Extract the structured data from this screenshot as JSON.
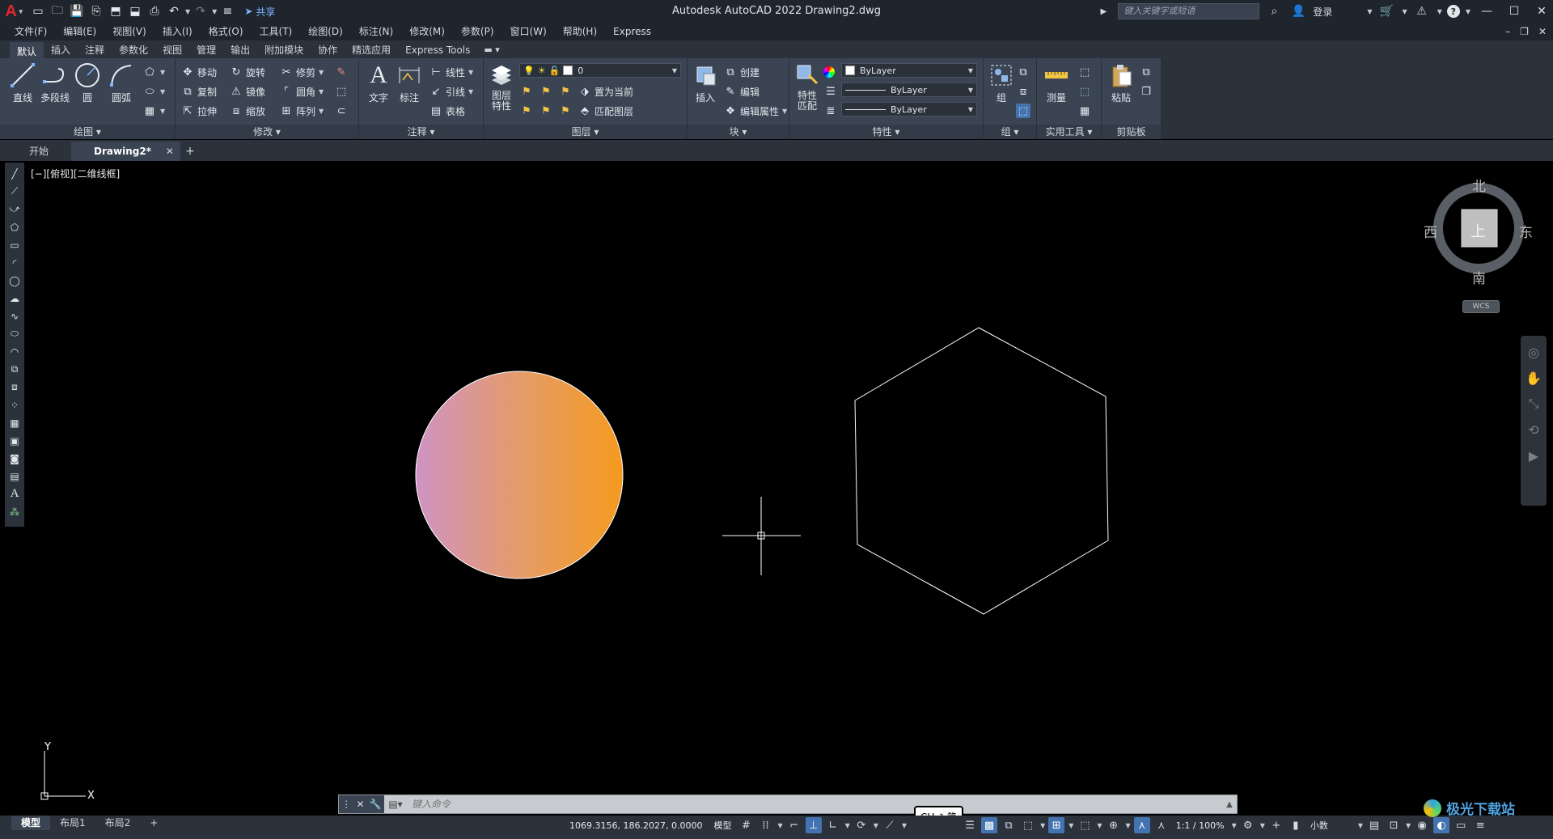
{
  "titlebar": {
    "app_logo": "A",
    "share_label": "共享",
    "window_title": "Autodesk AutoCAD 2022    Drawing2.dwg",
    "search_placeholder": "键入关键字或短语",
    "login_label": "登录"
  },
  "menubar": {
    "items": [
      "文件(F)",
      "编辑(E)",
      "视图(V)",
      "插入(I)",
      "格式(O)",
      "工具(T)",
      "绘图(D)",
      "标注(N)",
      "修改(M)",
      "参数(P)",
      "窗口(W)",
      "帮助(H)",
      "Express"
    ]
  },
  "ribbon_tabs": [
    "默认",
    "插入",
    "注释",
    "参数化",
    "视图",
    "管理",
    "输出",
    "附加模块",
    "协作",
    "精选应用",
    "Express Tools"
  ],
  "ribbon": {
    "draw": {
      "title": "绘图",
      "line": "直线",
      "polyline": "多段线",
      "circle": "圆",
      "arc": "圆弧"
    },
    "modify": {
      "title": "修改",
      "move": "移动",
      "rotate": "旋转",
      "trim": "修剪",
      "copy": "复制",
      "mirror": "镜像",
      "fillet": "圆角",
      "stretch": "拉伸",
      "scale": "缩放",
      "array": "阵列"
    },
    "annotation": {
      "title": "注释",
      "text": "文字",
      "dimension": "标注",
      "linear": "线性",
      "leader": "引线",
      "table": "表格"
    },
    "layers": {
      "title": "图层",
      "layer_props_line1": "图层",
      "layer_props_line2": "特性",
      "current_layer": "0",
      "make_current": "置为当前",
      "match_layer": "匹配图层"
    },
    "block": {
      "title": "块",
      "insert": "插入",
      "create": "创建",
      "edit": "编辑",
      "edit_attr": "编辑属性"
    },
    "properties": {
      "title": "特性",
      "match_line1": "特性",
      "match_line2": "匹配",
      "color": "ByLayer",
      "linetype": "ByLayer",
      "lineweight": "ByLayer"
    },
    "groups": {
      "title": "组",
      "group": "组"
    },
    "utilities": {
      "title": "实用工具",
      "measure": "测量"
    },
    "clipboard": {
      "title": "剪贴板",
      "paste": "粘贴"
    }
  },
  "file_tabs": {
    "start": "开始",
    "drawing": "Drawing2*"
  },
  "viewport": {
    "label": "[−][俯视][二维线框]"
  },
  "viewcube": {
    "north": "北",
    "south": "南",
    "east": "东",
    "west": "西",
    "face": "上",
    "wcs": "WCS"
  },
  "ucs": {
    "y": "Y",
    "x": "X"
  },
  "command_line": {
    "placeholder": "键入命令"
  },
  "statusbar": {
    "layout_tabs": [
      "模型",
      "布局1",
      "布局2"
    ],
    "coords": "1069.3156, 186.2027, 0.0000",
    "model_label": "模型",
    "scale_label": "1:1 / 100%",
    "units_label": "小数"
  },
  "ime": {
    "label": "CH ♪ 简"
  },
  "watermark": {
    "text": "极光下载站"
  },
  "colors": {
    "ribbon_bg": "#3b4453",
    "accent_blue": "#4373b0",
    "gradient_start": "#cf93c4",
    "gradient_end": "#f59a1e",
    "autocad_red": "#e0262d"
  }
}
